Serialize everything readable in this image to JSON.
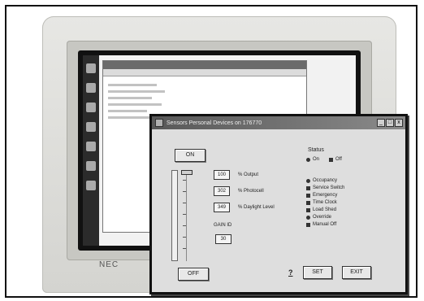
{
  "monitor": {
    "brand": "NEC"
  },
  "dialog": {
    "title": "Sensors Personal Devices on 176770",
    "window_buttons": [
      "_",
      "□",
      "x"
    ],
    "on_label": "ON",
    "off_label": "OFF",
    "set_label": "SET",
    "exit_label": "EXIT",
    "help_label": "?",
    "readouts": [
      {
        "value": "100",
        "label": "% Output"
      },
      {
        "value": "302",
        "label": "% Photocell"
      },
      {
        "value": "349",
        "label": "% Daylight Level"
      }
    ],
    "gain_label": "GAIN ID",
    "gain_value": "30"
  },
  "status": {
    "title": "Status",
    "on_label": "On",
    "off_label": "Off",
    "items": [
      "Occupancy",
      "Service Switch",
      "Emergency",
      "Time Clock",
      "Load Shed",
      "Override",
      "Manual Off"
    ]
  }
}
